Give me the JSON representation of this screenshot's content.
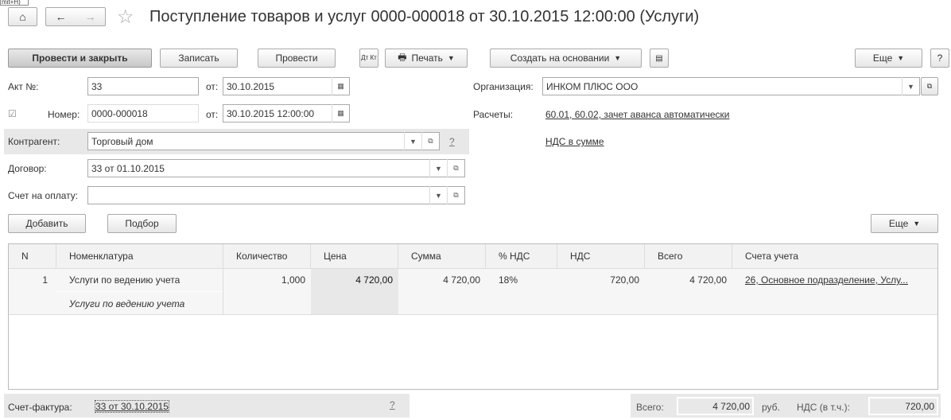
{
  "tooltip": "mit+H)",
  "title": "Поступление товаров и услуг 0000-000018 от 30.10.2015 12:00:00 (Услуги)",
  "toolbar": {
    "post_close": "Провести и закрыть",
    "save": "Записать",
    "post": "Провести",
    "dtkt": "Дт Кт",
    "print": "Печать",
    "create_based": "Создать на основании",
    "more": "Еще",
    "help": "?"
  },
  "form": {
    "act_label": "Акт №:",
    "act_value": "33",
    "from_label": "от:",
    "act_date": "30.10.2015",
    "number_label": "Номер:",
    "number_value": "0000-000018",
    "number_date": "30.10.2015 12:00:00",
    "counterparty_label": "Контрагент:",
    "counterparty_value": "Торговый дом",
    "help": "?",
    "contract_label": "Договор:",
    "contract_value": "33 от 01.10.2015",
    "invoice_pay_label": "Счет на оплату:",
    "invoice_pay_value": "",
    "org_label": "Организация:",
    "org_value": "ИНКОМ ПЛЮС ООО",
    "settlements_label": "Расчеты:",
    "settlements_link": "60.01, 60.02, зачет аванса автоматически",
    "vat_link": "НДС в сумме"
  },
  "table_toolbar": {
    "add": "Добавить",
    "pick": "Подбор",
    "more": "Еще"
  },
  "table": {
    "columns": [
      "N",
      "Номенклатура",
      "Количество",
      "Цена",
      "Сумма",
      "% НДС",
      "НДС",
      "Всего",
      "Счета учета"
    ],
    "rows": [
      {
        "n": "1",
        "item": "Услуги по ведению учета",
        "item_desc": "Услуги по ведению учета",
        "qty": "1,000",
        "price": "4 720,00",
        "sum": "4 720,00",
        "vat_rate": "18%",
        "vat": "720,00",
        "total": "4 720,00",
        "accounts": "26, Основное подразделение, Услу..."
      }
    ]
  },
  "footer": {
    "invoice_label": "Счет-фактура:",
    "invoice_link": "33 от 30.10.2015",
    "help": "?",
    "total_label": "Всего:",
    "total_value": "4 720,00",
    "currency": "руб.",
    "vat_label": "НДС (в т.ч.):",
    "vat_value": "720,00"
  }
}
